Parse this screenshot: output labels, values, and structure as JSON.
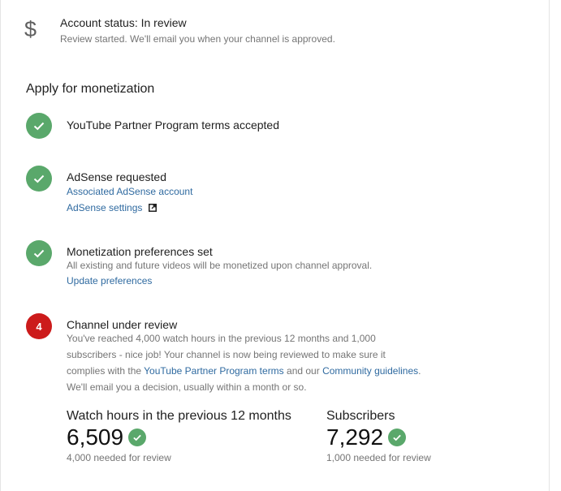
{
  "account_status": {
    "icon": "dollar-sign-icon",
    "title": "Account status: In review",
    "subtitle": "Review started. We'll email you when your channel is approved."
  },
  "section_title": "Apply for monetization",
  "colors": {
    "success": "#5aa86b",
    "alert": "#cc1b1b",
    "link": "#2f6aa0"
  },
  "steps": [
    {
      "status": "done",
      "icon": "checkmark-icon",
      "title": "YouTube Partner Program terms accepted"
    },
    {
      "status": "done",
      "icon": "checkmark-icon",
      "title": "AdSense requested",
      "links": [
        "Associated AdSense account",
        "AdSense settings"
      ],
      "external_icon": "external-link-icon"
    },
    {
      "status": "done",
      "icon": "checkmark-icon",
      "title": "Monetization preferences set",
      "description": "All existing and future videos will be monetized upon channel approval.",
      "link": "Update preferences"
    },
    {
      "status": "current",
      "number": "4",
      "title": "Channel under review",
      "desc_line1": "You've reached 4,000 watch hours in the previous 12 months and 1,000",
      "desc_line2": "subscribers - nice job! Your channel is now being reviewed to make sure it",
      "desc_line3_prefix": "complies with the ",
      "desc_line3_link1": "YouTube Partner Program terms",
      "desc_line3_mid": " and our ",
      "desc_line3_link2": "Community guidelines",
      "desc_line3_suffix": ".",
      "desc_line4": "We'll email you a decision, usually within a month or so."
    }
  ],
  "stats": [
    {
      "label": "Watch hours in the previous 12 months",
      "value": "6,509",
      "note": "4,000 needed for review",
      "icon": "checkmark-icon"
    },
    {
      "label": "Subscribers",
      "value": "7,292",
      "note": "1,000 needed for review",
      "icon": "checkmark-icon"
    }
  ]
}
